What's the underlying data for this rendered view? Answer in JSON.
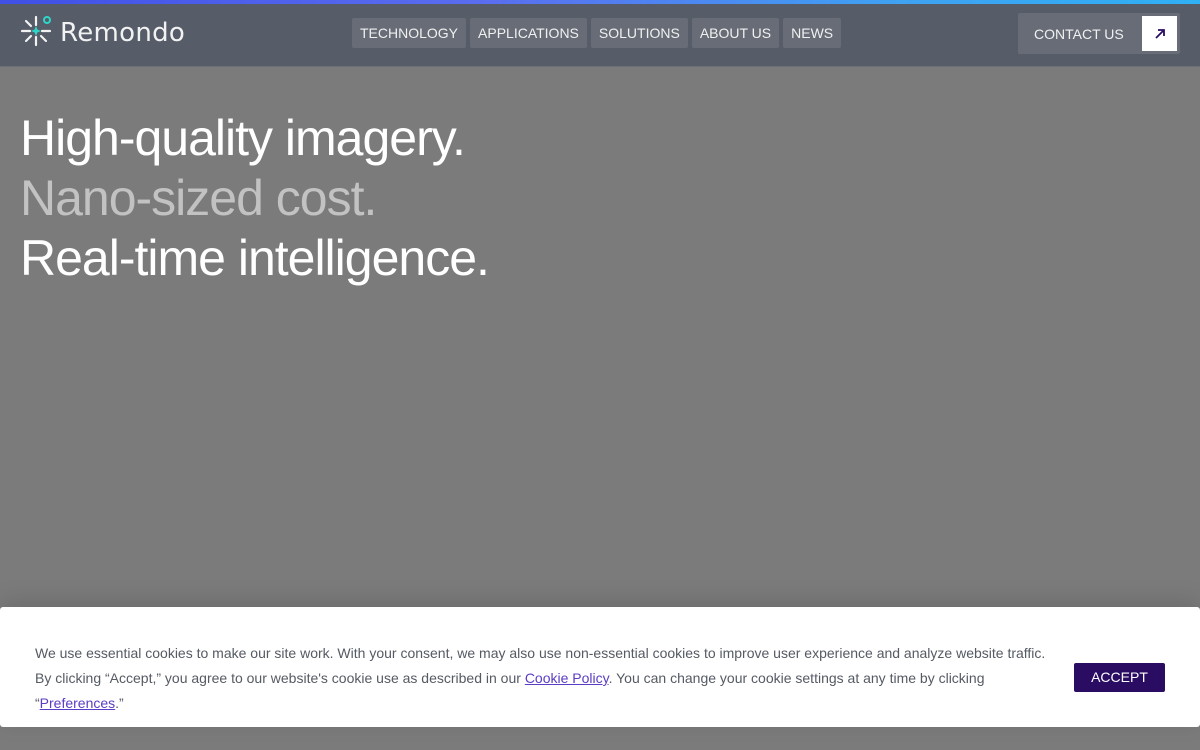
{
  "brand": {
    "name": "Remondo",
    "icon": "remondo-sparkle-logo",
    "accent": "#2fd6c8"
  },
  "nav": {
    "items": [
      "TECHNOLOGY",
      "APPLICATIONS",
      "SOLUTIONS",
      "ABOUT US",
      "NEWS"
    ],
    "contact_label": "CONTACT US",
    "contact_icon": "arrow-up-right-icon"
  },
  "hero": {
    "line1": "High-quality imagery.",
    "line2": "Nano-sized cost.",
    "line3": "Real-time intelligence."
  },
  "cookie_banner": {
    "text_part1": "We use essential cookies to make our site work. With your consent, we may also use non-essential cookies to improve user experience and analyze website traffic. By clicking “Accept,” you agree to our website's cookie use as described in our ",
    "policy_link": "Cookie Policy",
    "text_part2": ". You can change your cookie settings at any time by clicking “",
    "preferences_link": "Preferences",
    "text_part3": ".”",
    "accept_label": "ACCEPT",
    "accept_color": "#2a0d63"
  }
}
